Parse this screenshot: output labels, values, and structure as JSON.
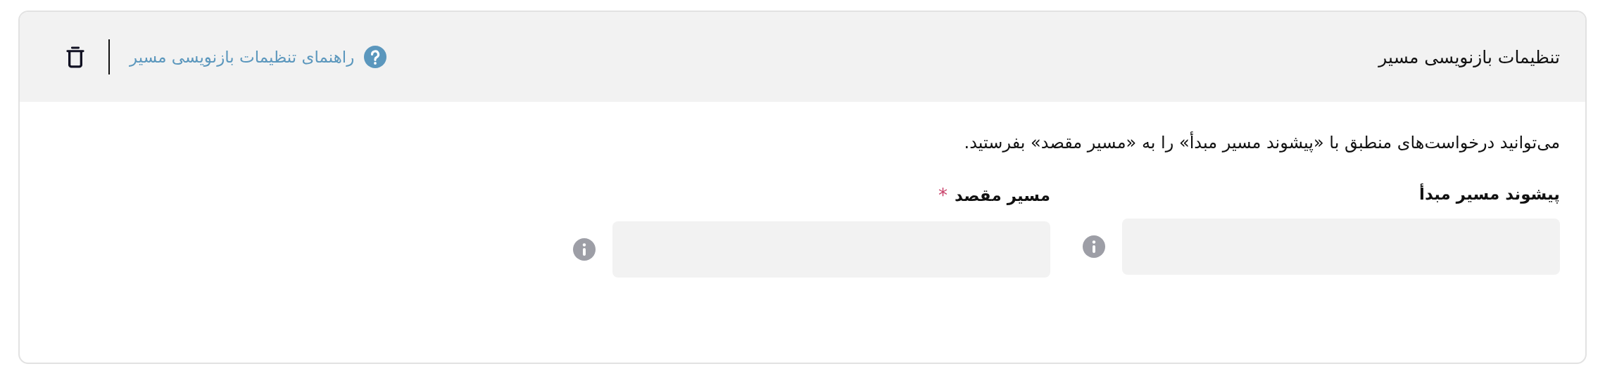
{
  "card": {
    "title": "تنظیمات بازنویسی مسیر",
    "help_link": "راهنمای تنظیمات بازنویسی مسیر"
  },
  "description": "می‌توانید درخواست‌های منطبق با «پیشوند مسیر مبدأ» را به «مسیر مقصد» بفرستید.",
  "fields": [
    {
      "label": "پیشوند مسیر مبدأ"
    },
    {
      "label": "مسیر مقصد",
      "required_mark": "*"
    }
  ]
}
